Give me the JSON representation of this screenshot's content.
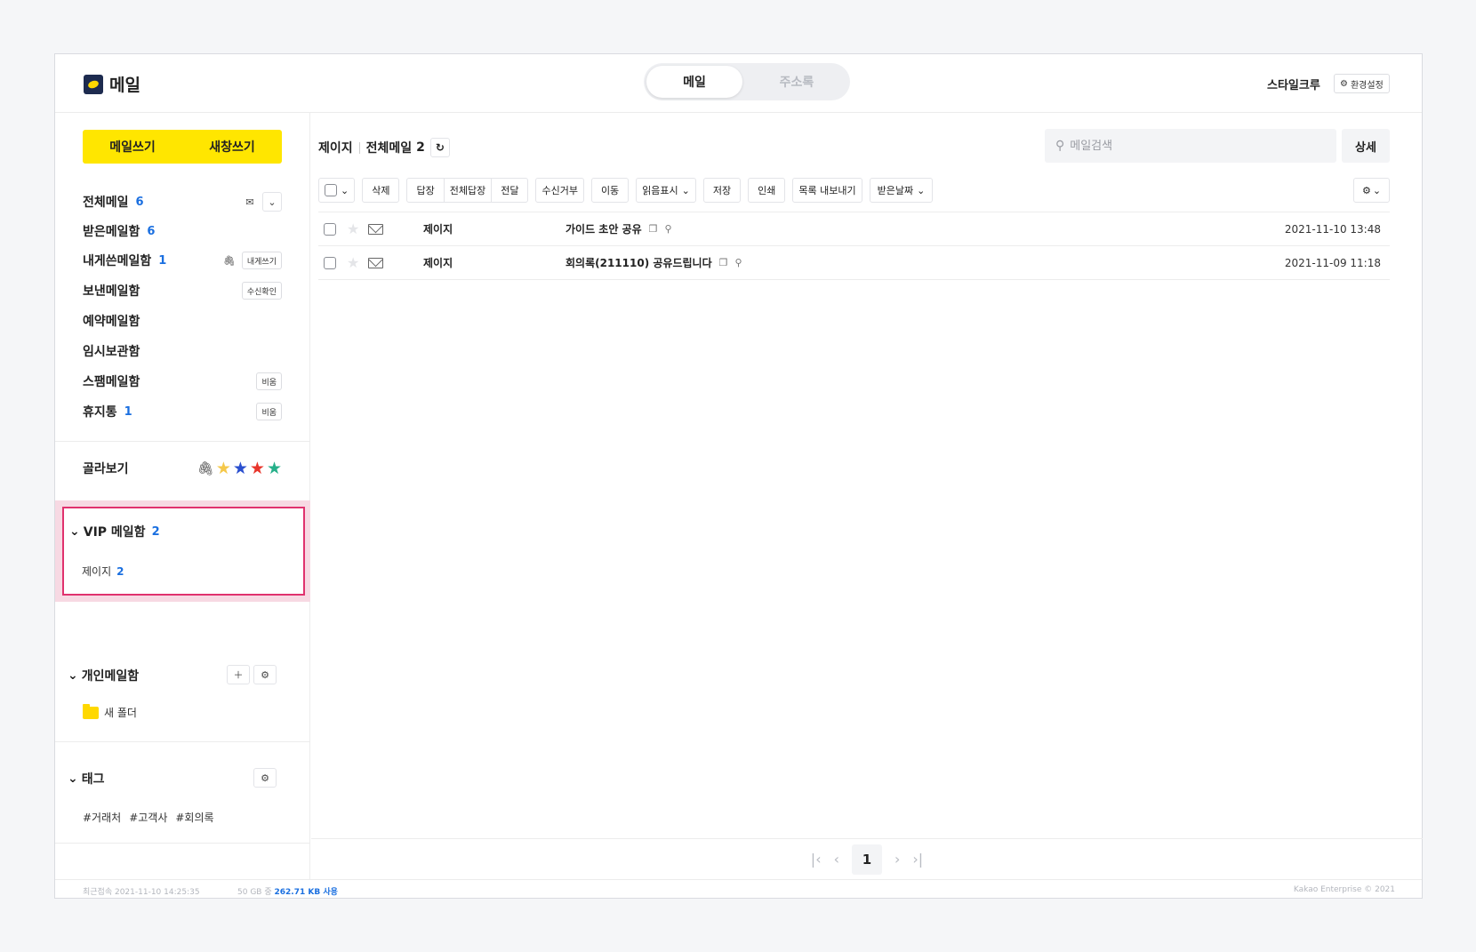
{
  "header": {
    "app_title": "메일",
    "tabs": [
      {
        "label": "메일"
      },
      {
        "label": "주소록"
      }
    ],
    "user_name": "스타일크루",
    "settings_label": "환경설정"
  },
  "sidebar": {
    "compose_label": "메일쓰기",
    "compose_new_window_label": "새창쓰기",
    "folders": [
      {
        "label": "전체메일",
        "count": "6"
      },
      {
        "label": "받은메일함",
        "count": "6"
      },
      {
        "label": "내게쓴메일함",
        "count": "1",
        "action": "내게쓰기"
      },
      {
        "label": "보낸메일함",
        "action": "수신확인"
      },
      {
        "label": "예약메일함"
      },
      {
        "label": "임시보관함"
      },
      {
        "label": "스팸메일함",
        "action": "비움"
      },
      {
        "label": "휴지통",
        "count": "1",
        "action": "비움"
      }
    ],
    "filter_label": "골라보기",
    "filter_star_colors": [
      "#f5c84a",
      "#2a4fcf",
      "#e8352b",
      "#26b08a"
    ],
    "vip": {
      "label": "VIP 메일함",
      "count": "2",
      "items": [
        {
          "label": "제이지",
          "count": "2"
        }
      ]
    },
    "personal": {
      "label": "개인메일함",
      "items": [
        {
          "label": "새 폴더"
        }
      ]
    },
    "tags": {
      "label": "태그",
      "items": [
        "#거래처",
        "#고객사",
        "#회의록"
      ]
    }
  },
  "main": {
    "breadcrumb": {
      "folder": "제이지",
      "view": "전체메일",
      "count": "2"
    },
    "search": {
      "placeholder": "메일검색",
      "detail_label": "상세"
    },
    "toolbar": {
      "delete": "삭제",
      "reply": "답장",
      "reply_all": "전체답장",
      "forward": "전달",
      "block": "수신거부",
      "move": "이동",
      "mark_read": "읽음표시",
      "save": "저장",
      "print": "인쇄",
      "export": "목록 내보내기",
      "sort": "받은날짜"
    },
    "messages": [
      {
        "from": "제이지",
        "subject": "가이드 초안 공유",
        "date": "2021-11-10 13:48"
      },
      {
        "from": "제이지",
        "subject": "회의록(211110) 공유드립니다",
        "date": "2021-11-09 11:18"
      }
    ],
    "pagination": {
      "current": "1"
    }
  },
  "footer": {
    "last_login": "최근접속 2021-11-10 14:25:35",
    "usage_total": "50 GB 중",
    "usage_used": "262.71 KB 사용",
    "copyright": "Kakao Enterprise © 2021"
  }
}
